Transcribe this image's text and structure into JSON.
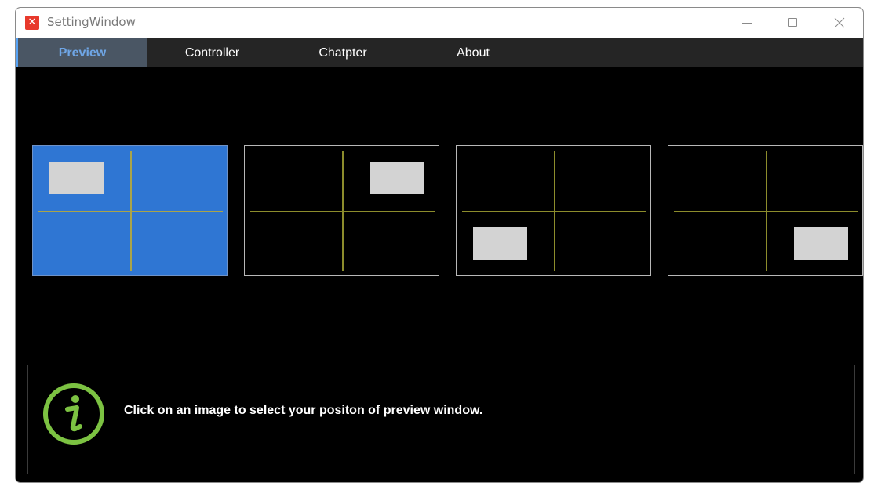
{
  "window": {
    "title": "SettingWindow",
    "app_icon": "app-logo-icon",
    "controls": {
      "minimize_icon": "minimize-icon",
      "maximize_icon": "maximize-icon",
      "close_icon": "close-icon"
    }
  },
  "tabs": [
    {
      "label": "Preview",
      "active": true
    },
    {
      "label": "Controller",
      "active": false
    },
    {
      "label": "Chatpter",
      "active": false
    },
    {
      "label": "About",
      "active": false
    }
  ],
  "positions": [
    {
      "id": "top-left",
      "selected": true
    },
    {
      "id": "top-right",
      "selected": false
    },
    {
      "id": "bottom-left",
      "selected": false
    },
    {
      "id": "bottom-right",
      "selected": false
    }
  ],
  "info": {
    "icon": "info-icon",
    "message": "Click on an image to select your positon of preview window."
  },
  "colors": {
    "accent": "#2f76d3",
    "active_tab_text": "#6fa6e6",
    "info_icon": "#7cc242",
    "crosshair": "#8c8c2c",
    "background": "#000000"
  }
}
